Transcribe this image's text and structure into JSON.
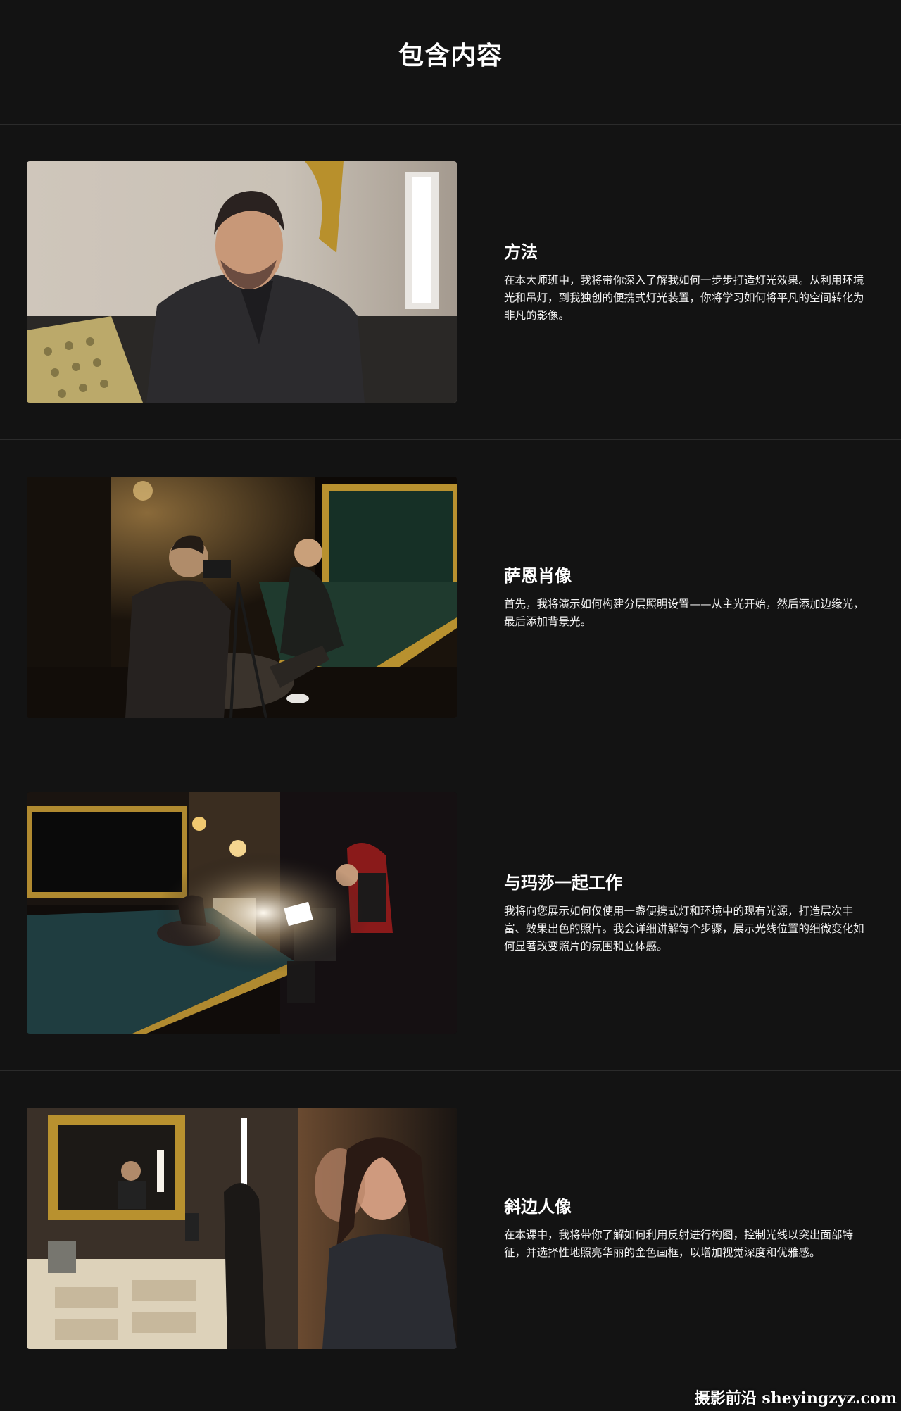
{
  "header": {
    "title": "包含内容"
  },
  "sections": [
    {
      "title": "方法",
      "description": "在本大师班中，我将带你深入了解我如何一步步打造灯光效果。从利用环境光和吊灯，到我独创的便携式灯光装置，你将学习如何将平凡的空间转化为非凡的影像。"
    },
    {
      "title": "萨恩肖像",
      "description": "首先，我将演示如何构建分层照明设置——从主光开始，然后添加边缘光，最后添加背景光。"
    },
    {
      "title": "与玛莎一起工作",
      "description": "我将向您展示如何仅使用一盏便携式灯和环境中的现有光源，打造层次丰富、效果出色的照片。我会详细讲解每个步骤，展示光线位置的细微变化如何显著改变照片的氛围和立体感。"
    },
    {
      "title": "斜边人像",
      "description": "在本课中，我将带你了解如何利用反射进行构图，控制光线以突出面部特征，并选择性地照亮华丽的金色画框，以增加视觉深度和优雅感。"
    }
  ],
  "watermark": {
    "text": "摄影前沿 sheyingzyz.com"
  }
}
